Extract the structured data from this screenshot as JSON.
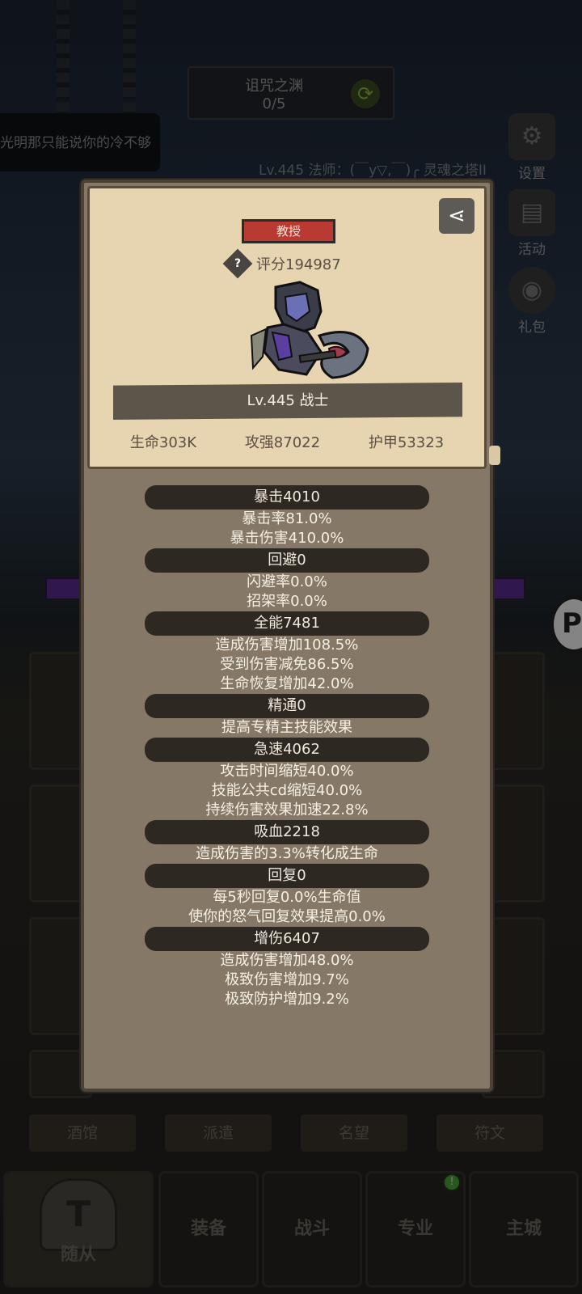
{
  "background": {
    "dungeon": {
      "name": "诅咒之渊",
      "progress": "0/5"
    },
    "marquee": "光明那只能说你的冷不够",
    "level_line": "Lv.445 法师：(￣y▽,￣)╭ 灵魂之塔II",
    "side_buttons": [
      {
        "label": "设置",
        "icon": "gear-icon"
      },
      {
        "label": "活动",
        "icon": "scroll-icon"
      },
      {
        "label": "礼包",
        "icon": "gift-icon"
      }
    ],
    "tabs": [
      "酒馆",
      "派遣",
      "名望",
      "符文"
    ],
    "nav": [
      {
        "label": "随从",
        "icon": "helmet-icon",
        "active": true
      },
      {
        "label": "装备"
      },
      {
        "label": "战斗"
      },
      {
        "label": "专业",
        "badge": "!"
      },
      {
        "label": "主城"
      }
    ]
  },
  "modal": {
    "rank": "教授",
    "score_label": "评分194987",
    "level_class": "Lv.445 战士",
    "stats": {
      "hp": "生命303K",
      "atk": "攻强87022",
      "armor": "护甲53323"
    },
    "sections": [
      {
        "title": "暴击4010",
        "lines": [
          "暴击率81.0%",
          "暴击伤害410.0%"
        ]
      },
      {
        "title": "回避0",
        "lines": [
          "闪避率0.0%",
          "招架率0.0%"
        ]
      },
      {
        "title": "全能7481",
        "lines": [
          "造成伤害增加108.5%",
          "受到伤害减免86.5%",
          "生命恢复增加42.0%"
        ]
      },
      {
        "title": "精通0",
        "lines": [
          "提高专精主技能效果"
        ]
      },
      {
        "title": "急速4062",
        "lines": [
          "攻击时间缩短40.0%",
          "技能公共cd缩短40.0%",
          "持续伤害效果加速22.8%"
        ]
      },
      {
        "title": "吸血2218",
        "lines": [
          "造成伤害的3.3%转化成生命"
        ]
      },
      {
        "title": "回复0",
        "lines": [
          "每5秒回复0.0%生命值",
          "使你的怒气回复效果提高0.0%"
        ]
      },
      {
        "title": "增伤6407",
        "lines": [
          "造成伤害增加48.0%",
          "极致伤害增加9.7%",
          "极致防护增加9.2%"
        ]
      }
    ]
  },
  "colors": {
    "parchment": "#e7d4b1",
    "panel": "#857866",
    "section_bar": "#2e2822",
    "rank_red": "#b83a32"
  }
}
